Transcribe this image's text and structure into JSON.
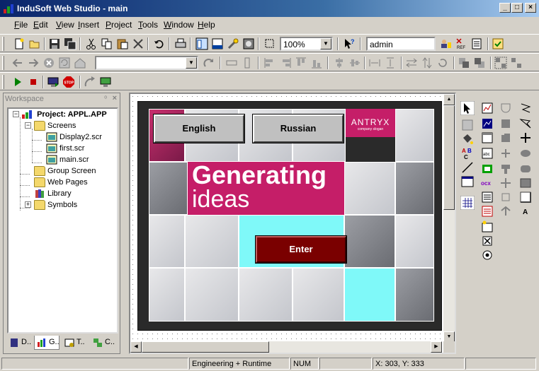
{
  "window": {
    "title": "InduSoft Web Studio - main",
    "minimize": "_",
    "maximize": "□",
    "close": "×"
  },
  "menu": [
    {
      "label": "File",
      "key": "F"
    },
    {
      "label": "Edit",
      "key": "E"
    },
    {
      "label": "View",
      "key": "V"
    },
    {
      "label": "Insert",
      "key": "I"
    },
    {
      "label": "Project",
      "key": "P"
    },
    {
      "label": "Tools",
      "key": "T"
    },
    {
      "label": "Window",
      "key": "W"
    },
    {
      "label": "Help",
      "key": "H"
    }
  ],
  "toolbar": {
    "zoom_value": "100%",
    "user_value": "admin",
    "font_combo_value": ""
  },
  "workspace": {
    "title": "Workspace",
    "pin": "ᵒ",
    "close": "×",
    "project_label": "Project: APPL.APP",
    "tree": {
      "screens": "Screens",
      "screen_files": [
        "Display2.scr",
        "first.scr",
        "main.scr"
      ],
      "group_screen": "Group Screen",
      "web_pages": "Web Pages",
      "library": "Library",
      "symbols": "Symbols"
    },
    "tabs": [
      "D..",
      "G..",
      "T..",
      "C.."
    ],
    "expander_minus": "−",
    "expander_plus": "+"
  },
  "screen": {
    "english_button": "English",
    "russian_button": "Russian",
    "enter_button": "Enter",
    "banner_line1": "Generating",
    "banner_line2": "ideas",
    "logo_name": "ANTRYX",
    "logo_slogan": "company slogan"
  },
  "status": {
    "mode": "Engineering + Runtime",
    "num": "NUM",
    "coords": "X: 303, Y: 333"
  },
  "colors": {
    "accent_magenta": "#c51e68",
    "enter_dark_red": "#7a0000",
    "cyan": "#7ff9f9",
    "title_blue": "#0a246a"
  }
}
